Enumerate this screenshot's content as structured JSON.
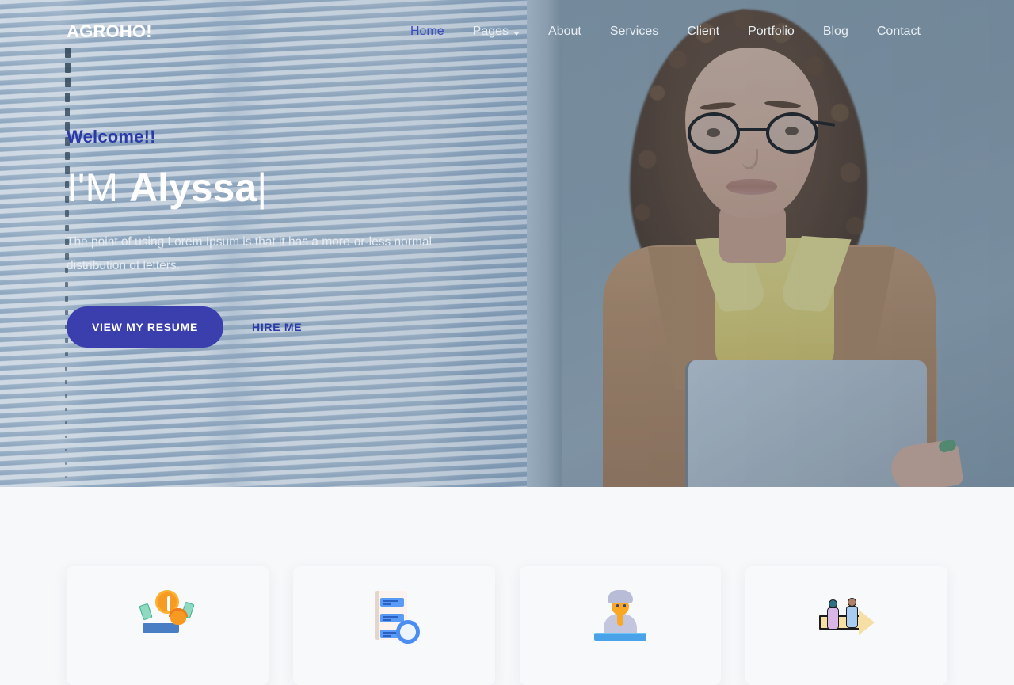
{
  "brand": {
    "logo": "AGROHO!"
  },
  "nav": {
    "items": [
      {
        "label": "Home",
        "active": true,
        "has_caret": false
      },
      {
        "label": "Pages",
        "active": false,
        "has_caret": true
      },
      {
        "label": "About",
        "active": false,
        "has_caret": false
      },
      {
        "label": "Services",
        "active": false,
        "has_caret": false
      },
      {
        "label": "Client",
        "active": false,
        "has_caret": false
      },
      {
        "label": "Portfolio",
        "active": false,
        "has_caret": false
      },
      {
        "label": "Blog",
        "active": false,
        "has_caret": false
      },
      {
        "label": "Contact",
        "active": false,
        "has_caret": false
      }
    ]
  },
  "hero": {
    "welcome": "Welcome!!",
    "headline_prefix": "I'M ",
    "headline_name": "Alyssa",
    "headline_cursor": "|",
    "lead": "The point of using Lorem Ipsum is that it has a more-or-less normal distribution of letters.",
    "primary_button": "VIEW MY RESUME",
    "secondary_link": "HIRE ME"
  },
  "features": {
    "cards": [
      {
        "icon": "coin-money-icon"
      },
      {
        "icon": "resume-document-icon"
      },
      {
        "icon": "person-desk-icon"
      },
      {
        "icon": "team-arrow-icon"
      }
    ]
  },
  "colors": {
    "accent_indigo": "#3b3fae",
    "accent_indigo_dark": "#2b3aa8",
    "hero_overlay": "#607c9e",
    "page_background": "#f7f8fa",
    "card_background": "#f8f9fb",
    "text_light": "#e6ecf2"
  }
}
